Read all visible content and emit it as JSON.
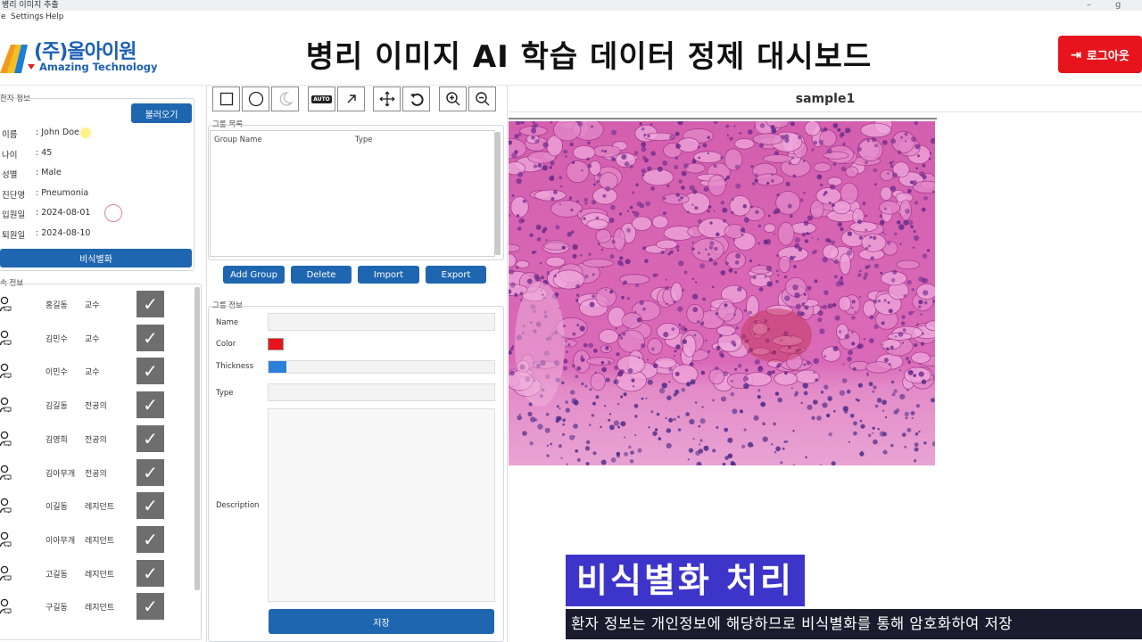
{
  "window": {
    "title": "병리 이미지 추출",
    "controls": [
      "–",
      "g"
    ]
  },
  "menu": [
    "e",
    "Settings",
    "Help"
  ],
  "header": {
    "logo_name": "(주)올아이원",
    "logo_sub": "Amazing Technology",
    "title": "병리 이미지 AI 학습 데이터 정제 대시보드",
    "logout_label": "로그아웃",
    "logout_icon": "logout-arrow-icon"
  },
  "patient": {
    "section_label": "환자 정보",
    "load_button": "불러오기",
    "fields": [
      {
        "label": "이름",
        "value": ": John Doe"
      },
      {
        "label": "나이",
        "value": ": 45"
      },
      {
        "label": "성별",
        "value": ": Male"
      },
      {
        "label": "진단명",
        "value": ": Pneumonia"
      },
      {
        "label": "입원일",
        "value": ": 2024-08-01"
      },
      {
        "label": "퇴원일",
        "value": ": 2024-08-10"
      }
    ],
    "anonymize_button": "비식별화"
  },
  "staff": {
    "section_label": "속 정보",
    "rows": [
      {
        "name": "홍길동",
        "role": "교수"
      },
      {
        "name": "김민수",
        "role": "교수"
      },
      {
        "name": "이민수",
        "role": "교수"
      },
      {
        "name": "김길동",
        "role": "전공의"
      },
      {
        "name": "김영희",
        "role": "전공의"
      },
      {
        "name": "김아무개",
        "role": "전공의"
      },
      {
        "name": "이길동",
        "role": "레지던트"
      },
      {
        "name": "이아무개",
        "role": "레지던트"
      },
      {
        "name": "고길동",
        "role": "레지던트"
      },
      {
        "name": "구길동",
        "role": "레지던트"
      }
    ],
    "check_glyph": "✓"
  },
  "toolbar": {
    "tools": [
      "rectangle-tool-icon",
      "circle-tool-icon",
      "lasso-tool-icon",
      "auto-tool-icon",
      "arrow-tool-icon",
      "move-tool-icon",
      "undo-icon",
      "zoom-in-icon",
      "zoom-out-icon"
    ],
    "auto_label": "AUTO"
  },
  "groups": {
    "section_label": "그룹 목록",
    "col_name": "Group Name",
    "col_type": "Type",
    "buttons": [
      "Add Group",
      "Delete",
      "Import",
      "Export"
    ]
  },
  "group_info": {
    "section_label": "그룹 정보",
    "labels": {
      "name": "Name",
      "color": "Color",
      "thickness": "Thickness",
      "type": "Type",
      "description": "Description"
    },
    "color_value": "#e8141c",
    "thickness_level": 0.08,
    "save_button": "저장"
  },
  "viewer": {
    "title": "sample1"
  },
  "caption": {
    "headline": "비식별화 처리",
    "body": "환자 정보는 개인정보에 해당하므로 비식별화를 통해 암호화하여 저장"
  }
}
